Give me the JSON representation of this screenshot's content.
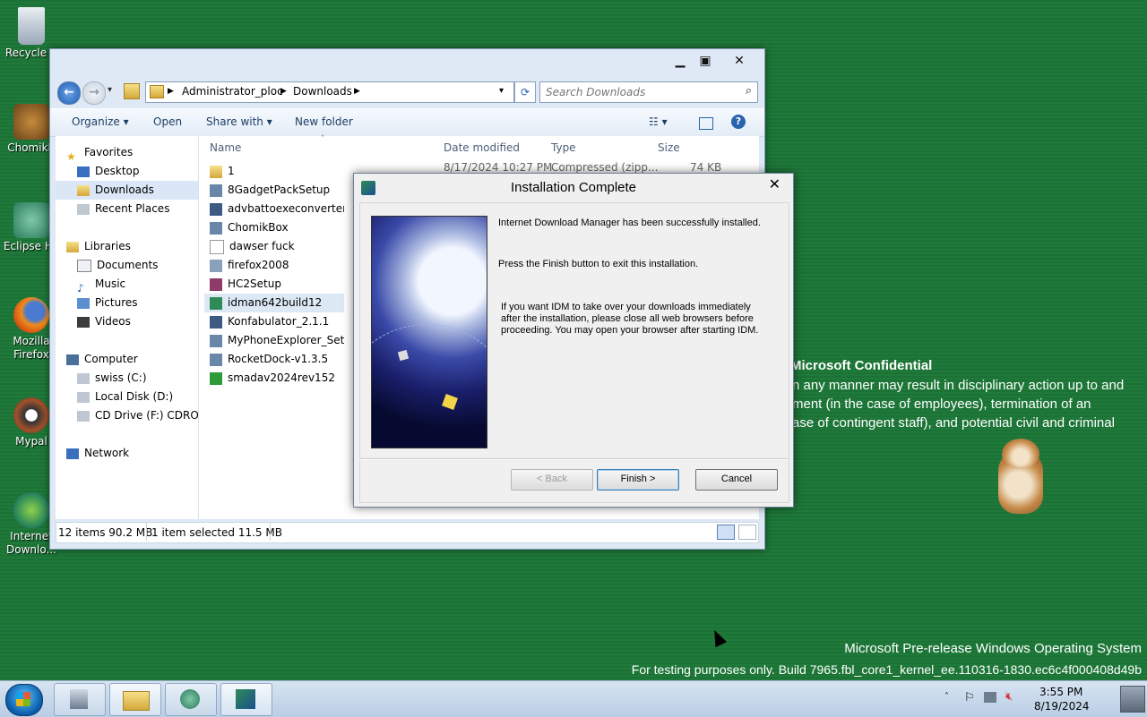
{
  "desktop": {
    "icons": [
      {
        "label": "Recycle B"
      },
      {
        "label": "ChomikB"
      },
      {
        "label": "Eclipse Hy"
      },
      {
        "label": "Mozilla Firefox"
      },
      {
        "label": "Mypal"
      },
      {
        "label": "Internet Downlo..."
      }
    ],
    "watermark": {
      "confidential_title": "Microsoft Confidential",
      "confidential_line1": "n any manner may result in disciplinary action up to and",
      "confidential_line2": "ment (in the case of employees), termination of an",
      "confidential_line3": "ase of contingent staff), and potential civil and criminal",
      "os_line": "Microsoft Pre-release Windows Operating System",
      "build_line": "For testing purposes only. Build 7965.fbl_core1_kernel_ee.110316-1830.ec6c4f000408d49b"
    }
  },
  "explorer": {
    "address": {
      "crumbs": [
        "Administrator_ploc",
        "Downloads"
      ]
    },
    "search_placeholder": "Search Downloads",
    "toolbar": {
      "organize": "Organize",
      "open": "Open",
      "share": "Share with",
      "new_folder": "New folder"
    },
    "nav": {
      "favorites": "Favorites",
      "desktop": "Desktop",
      "downloads": "Downloads",
      "recent": "Recent Places",
      "libraries": "Libraries",
      "documents": "Documents",
      "music": "Music",
      "pictures": "Pictures",
      "videos": "Videos",
      "computer": "Computer",
      "drive_c": "swiss (C:)",
      "drive_d": "Local Disk (D:)",
      "drive_f": "CD Drive (F:) CDROM",
      "network": "Network"
    },
    "columns": {
      "name": "Name",
      "date": "Date modified",
      "type": "Type",
      "size": "Size"
    },
    "first_row_partial": {
      "date": "8/17/2024 10:27 PM",
      "type": "Compressed (zipp...",
      "size": "74 KB"
    },
    "files": [
      "1",
      "8GadgetPackSetup",
      "advbattoexeconverter",
      "ChomikBox",
      "dawser fuck",
      "firefox2008",
      "HC2Setup",
      "idman642build12",
      "Konfabulator_2.1.1",
      "MyPhoneExplorer_Setup_",
      "RocketDock-v1.3.5",
      "smadav2024rev152"
    ],
    "status": {
      "items": "12 items  90.2 MB",
      "selected": "1 item selected  11.5 MB"
    }
  },
  "dialog": {
    "title": "Installation Complete",
    "line1": "Internet Download Manager has been successfully installed.",
    "line2": "Press the Finish button to exit this installation.",
    "line3a": "If you want IDM to take over your downloads immediately",
    "line3b": "after the installation, please close all web browsers before",
    "line3c": "proceeding. You may open your browser after starting IDM.",
    "back": "< Back",
    "finish": "Finish >",
    "cancel": "Cancel"
  },
  "taskbar": {
    "time": "3:55 PM",
    "date": "8/19/2024"
  }
}
